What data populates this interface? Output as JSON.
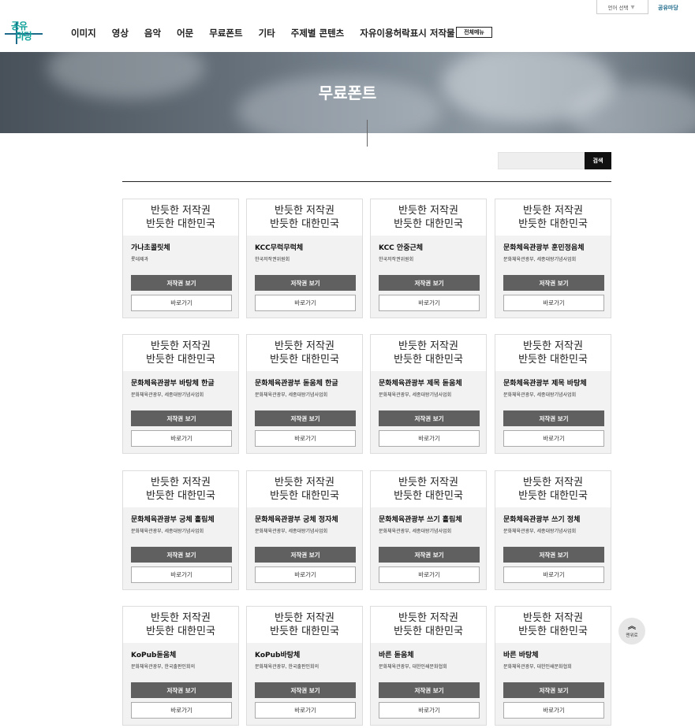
{
  "header": {
    "logo_line1": "공유",
    "logo_line2": "마당",
    "nav": [
      "이미지",
      "영상",
      "음악",
      "어문",
      "무료폰트",
      "기타",
      "주제별 콘텐츠",
      "자유이용허락표시 저작물"
    ],
    "all_menu_label": "전체메뉴",
    "lang_select_label": "언어 선택",
    "lang_select_arrow": "▼",
    "top_link": "공유마당"
  },
  "banner": {
    "title": "무료폰트"
  },
  "search": {
    "placeholder": "",
    "button_label": "검색"
  },
  "card_buttons": {
    "copyright_label": "저작권 보기",
    "go_label": "바로가기"
  },
  "cards": [
    {
      "preview": [
        "반듯한 저작권",
        "반듯한 대한민국"
      ],
      "name": "가나초콜릿체",
      "owner": "롯데제과"
    },
    {
      "preview": [
        "반듯한 저작권",
        "반듯한 대한민국"
      ],
      "name": "KCC무럭무럭체",
      "owner": "한국저작권위원회"
    },
    {
      "preview": [
        "반듯한 저작권",
        "반듯한 대한민국"
      ],
      "name": "KCC 안중근체",
      "owner": "한국저작권위원회"
    },
    {
      "preview": [
        "반듯한 저작권",
        "반듯한 대한민국"
      ],
      "name": "문화체육관광부 훈민정음체",
      "owner": "문화체육관광부, 세종대왕기념사업회"
    },
    {
      "preview": [
        "반듯한 저작권",
        "반듯한 대한민국"
      ],
      "name": "문화체육관광부 바탕체 한글",
      "owner": "문화체육관광부, 세종대왕기념사업회"
    },
    {
      "preview": [
        "반듯한 저작권",
        "반듯한 대한민국"
      ],
      "name": "문화체육관광부 돋움체 한글",
      "owner": "문화체육관광부, 세종대왕기념사업회"
    },
    {
      "preview": [
        "반듯한 저작권",
        "반듯한 대한민국"
      ],
      "name": "문화체육관광부 제목 돋움체",
      "owner": "문화체육관광부, 세종대왕기념사업회"
    },
    {
      "preview": [
        "반듯한 저작권",
        "반듯한 대한민국"
      ],
      "name": "문화체육관광부 제목 바탕체",
      "owner": "문화체육관광부, 세종대왕기념사업회"
    },
    {
      "preview": [
        "반듯한 저작권",
        "반듯한 대한민국"
      ],
      "name": "문화체육관광부 궁체 흘림체",
      "owner": "문화체육관광부, 세종대왕기념사업회"
    },
    {
      "preview": [
        "반듯한 저작권",
        "반듯한 대한민국"
      ],
      "name": "문화체육관광부 궁체 정자체",
      "owner": "문화체육관광부, 세종대왕기념사업회"
    },
    {
      "preview": [
        "반듯한 저작권",
        "반듯한 대한민국"
      ],
      "name": "문화체육관광부 쓰기 흘림체",
      "owner": "문화체육관광부, 세종대왕기념사업회"
    },
    {
      "preview": [
        "반듯한 저작권",
        "반듯한 대한민국"
      ],
      "name": "문화체육관광부 쓰기 정체",
      "owner": "문화체육관광부, 세종대왕기념사업회"
    },
    {
      "preview": [
        "반듯한 저작권",
        "반듯한 대한민국"
      ],
      "name": "KoPub돋움체",
      "owner": "문화체육관광부, 한국출판인회의"
    },
    {
      "preview": [
        "반듯한 저작권",
        "반듯한 대한민국"
      ],
      "name": "KoPub바탕체",
      "owner": "문화체육관광부, 한국출판인회의"
    },
    {
      "preview": [
        "반듯한 저작권",
        "반듯한 대한민국"
      ],
      "name": "바른 돋움체",
      "owner": "문화체육관광부, 대한인쇄문화협회"
    },
    {
      "preview": [
        "반듯한 저작권",
        "반듯한 대한민국"
      ],
      "name": "바른 바탕체",
      "owner": "문화체육관광부, 대한인쇄문화협회"
    }
  ],
  "to_top": {
    "label": "맨위로",
    "icon": "double-chevron-up-icon"
  },
  "colors": {
    "brand": "#12a29b",
    "dark_button": "#606060",
    "search_button": "#111111"
  }
}
